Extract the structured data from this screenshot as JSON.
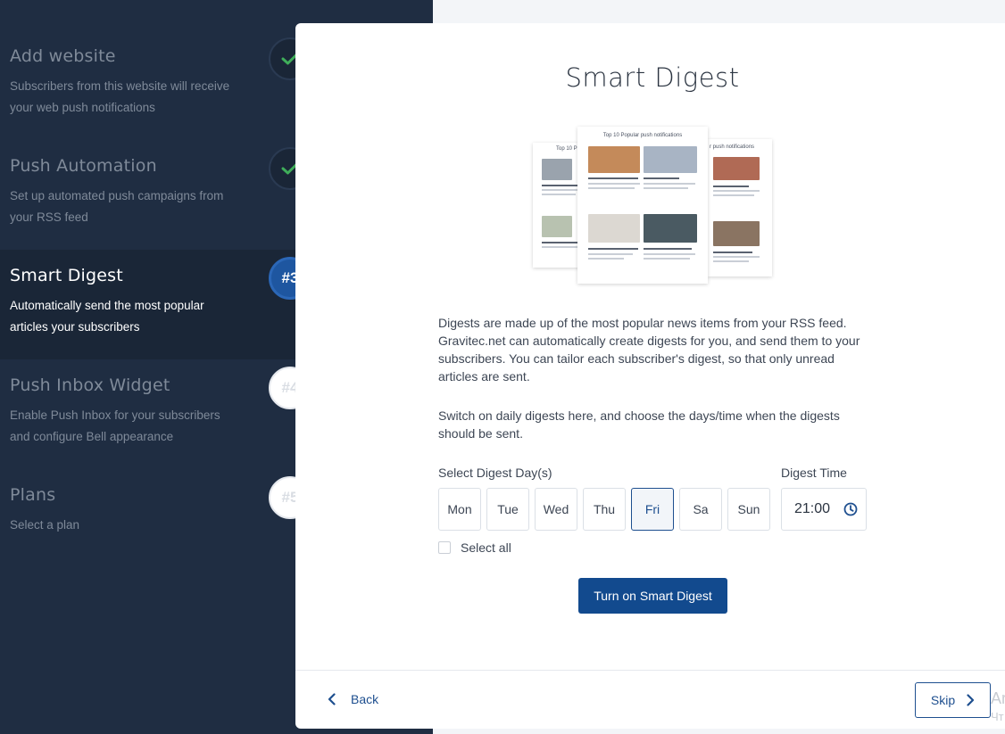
{
  "sidebar": {
    "steps": [
      {
        "title": "Add website",
        "desc": "Subscribers from this website will receive your web push notifications",
        "badge": "",
        "status": "done"
      },
      {
        "title": "Push Automation",
        "desc": "Set up automated push campaigns from your RSS feed",
        "badge": "",
        "status": "done"
      },
      {
        "title": "Smart Digest",
        "desc": "Automatically send the most popular articles your subscribers",
        "badge": "#3",
        "status": "current"
      },
      {
        "title": "Push Inbox Widget",
        "desc": "Enable Push Inbox for your subscribers and configure Bell appearance",
        "badge": "#4",
        "status": "todo"
      },
      {
        "title": "Plans",
        "desc": "Select a plan",
        "badge": "#5",
        "status": "todo"
      }
    ]
  },
  "modal": {
    "title": "Smart Digest",
    "illustration": {
      "front_heading": "Top 10 Popular push notifications",
      "left_heading": "Top 10 P",
      "right_heading": "r push notifications"
    },
    "paragraph1": "Digests are made up of the most popular news items from your RSS feed. Gravitec.net can automatically create digests for you, and send them to your subscribers. You can tailor each subscriber's digest, so that only unread articles are sent.",
    "paragraph2": "Switch on daily digests here, and choose the days/time when the digests should be sent.",
    "days_label": "Select Digest Day(s)",
    "time_label": "Digest Time",
    "days": [
      {
        "label": "Mon",
        "selected": false
      },
      {
        "label": "Tue",
        "selected": false
      },
      {
        "label": "Wed",
        "selected": false
      },
      {
        "label": "Thu",
        "selected": false
      },
      {
        "label": "Fri",
        "selected": true
      },
      {
        "label": "Sa",
        "selected": false
      },
      {
        "label": "Sun",
        "selected": false
      }
    ],
    "time_value": "21:00",
    "select_all_label": "Select all",
    "select_all_checked": false,
    "cta_label": "Turn on Smart Digest",
    "back_label": "Back",
    "skip_label": "Skip"
  },
  "edge": {
    "line1": "Ar",
    "line2": "Чт"
  },
  "colors": {
    "sidebar_bg": "#1f2d42",
    "active_step_bg": "#1a2637",
    "accent": "#124a8e",
    "check": "#3fae5a"
  }
}
